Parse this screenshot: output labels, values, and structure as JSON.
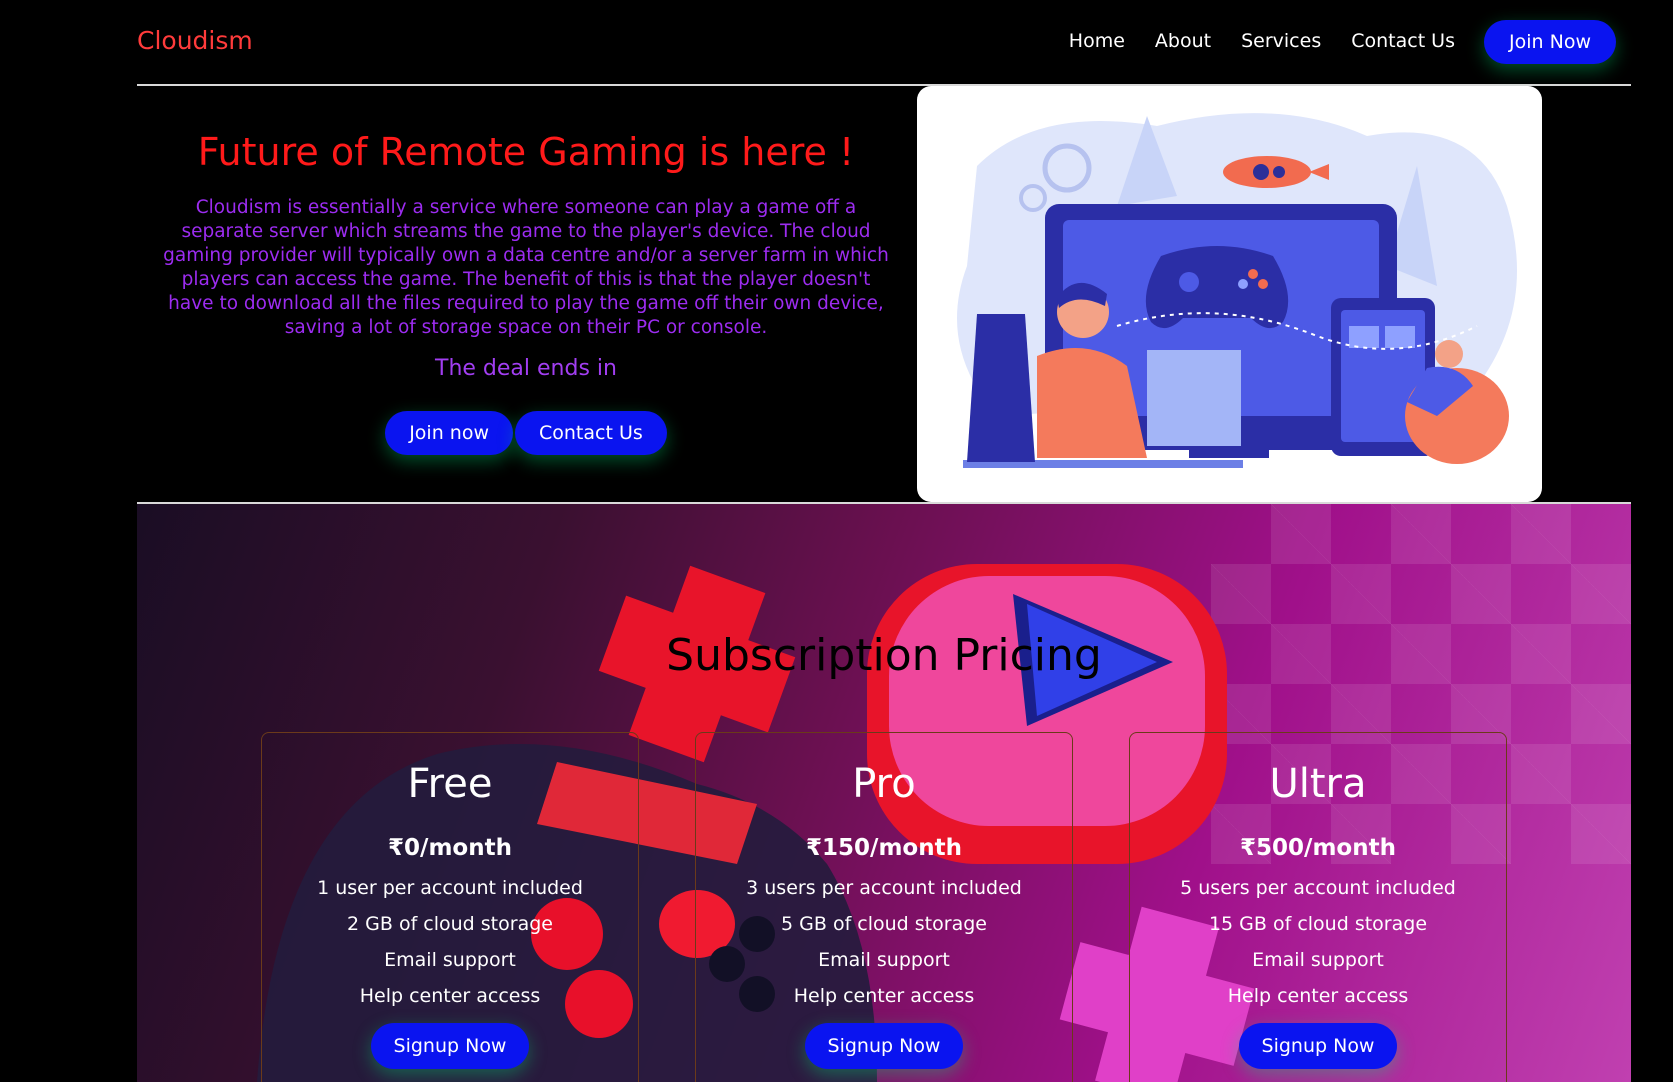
{
  "nav": {
    "brand": "Cloudism",
    "links": [
      "Home",
      "About",
      "Services",
      "Contact Us"
    ],
    "join_label": "Join Now"
  },
  "hero": {
    "title": "Future of Remote Gaming is here !",
    "description": "Cloudism is essentially a service where someone can play a game off a separate server which streams the game to the player's device. The cloud gaming provider will typically own a data centre and/or a server farm in which players can access the game. The benefit of this is that the player doesn't have to download all the files required to play the game off their own device, saving a lot of storage space on their PC or console.",
    "deal_text": "The deal ends in",
    "join_button": "Join now",
    "contact_button": "Contact Us"
  },
  "pricing": {
    "title": "Subscription Pricing",
    "plans": [
      {
        "name": "Free",
        "price": "₹0/month",
        "features": [
          "1 user per account included",
          "2 GB of cloud storage",
          "Email support",
          "Help center access"
        ],
        "signup": "Signup Now"
      },
      {
        "name": "Pro",
        "price": "₹150/month",
        "features": [
          "3 users per account included",
          "5 GB of cloud storage",
          "Email support",
          "Help center access"
        ],
        "signup": "Signup Now"
      },
      {
        "name": "Ultra",
        "price": "₹500/month",
        "features": [
          "5 users per account included",
          "15 GB of cloud storage",
          "Email support",
          "Help center access"
        ],
        "signup": "Signup Now"
      }
    ]
  },
  "colors": {
    "brand": "#ff3b3b",
    "accent_button": "#0a14f0",
    "hero_title": "#ff1a1a",
    "hero_text": "#9c2cf0"
  }
}
